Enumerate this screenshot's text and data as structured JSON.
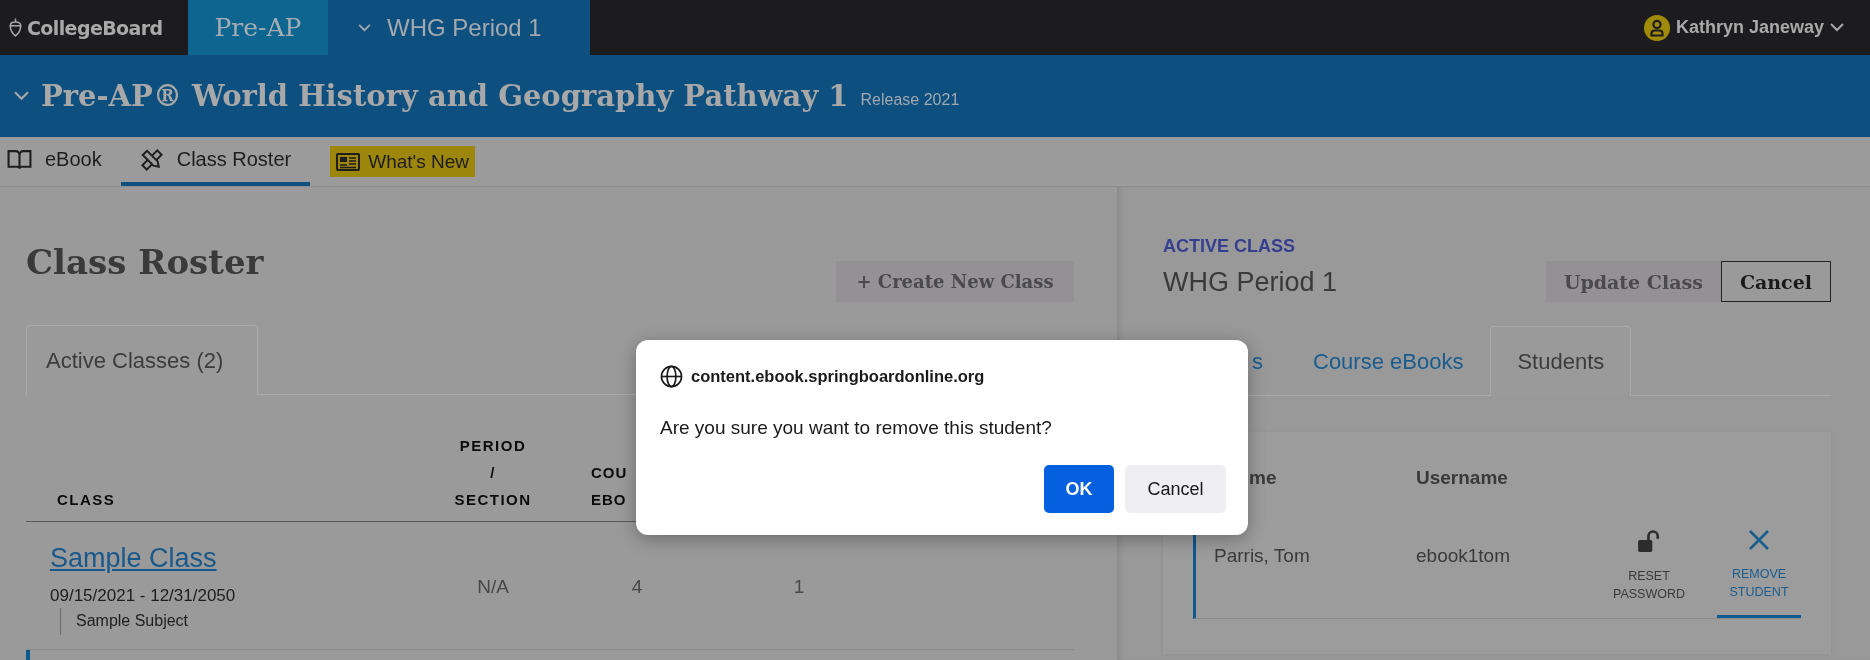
{
  "top_bar": {
    "logo": "CollegeBoard",
    "product_tab": {
      "label": "Pre-AP",
      "selected": true
    },
    "class_selector": {
      "label": "WHG Period 1"
    },
    "user": {
      "name": "Kathryn Janeway"
    }
  },
  "course_header": {
    "title": "Pre-AP® World History and Geography Pathway 1",
    "release": "Release 2021"
  },
  "nav": [
    {
      "label": "eBook",
      "selected": false,
      "highlighted": false
    },
    {
      "label": "Class Roster",
      "selected": true,
      "highlighted": false
    },
    {
      "label": "What's New",
      "selected": false,
      "highlighted": true
    }
  ],
  "roster": {
    "title": "Class Roster",
    "create_button": {
      "label": "+ Create New Class",
      "disabled": true
    },
    "tabs": [
      {
        "label": "Active Classes (2)",
        "selected": true
      }
    ],
    "table": {
      "columns": [
        "CLASS",
        "PERIOD / SECTION",
        "COU EBO"
      ],
      "rows": [
        {
          "cells": [
            {
              "kind": "class",
              "link": "Sample Class",
              "dates": "09/15/2021 - 12/31/2050",
              "subject": "Sample Subject"
            },
            {
              "kind": "text",
              "text": "N/A"
            },
            {
              "kind": "text",
              "text": "4"
            },
            {
              "kind": "text",
              "text": "1"
            }
          ]
        }
      ]
    }
  },
  "active_class": {
    "label": "ACTIVE CLASS",
    "name": "WHG Period 1",
    "buttons": [
      {
        "label": "Update Class",
        "kind": "filled",
        "disabled": true
      },
      {
        "label": "Cancel",
        "kind": "outline",
        "disabled": false
      }
    ],
    "tabs": [
      {
        "label": "s",
        "selected": false
      },
      {
        "label": "Course eBooks",
        "selected": false
      },
      {
        "label": "Students",
        "selected": true
      }
    ],
    "students": {
      "columns": [
        "me",
        "Username"
      ],
      "rows": [
        {
          "name": "Parris, Tom",
          "username": "ebook1tom",
          "actions": [
            {
              "label": "RESET PASSWORD",
              "kind": "reset",
              "selected": false
            },
            {
              "label": "REMOVE STUDENT",
              "kind": "remove",
              "selected": true
            }
          ]
        }
      ]
    }
  },
  "dialog": {
    "origin": "content.ebook.springboardonline.org",
    "message": "Are you sure you want to remove this student?",
    "buttons": [
      {
        "label": "OK",
        "kind": "primary"
      },
      {
        "label": "Cancel",
        "kind": "secondary"
      }
    ]
  }
}
